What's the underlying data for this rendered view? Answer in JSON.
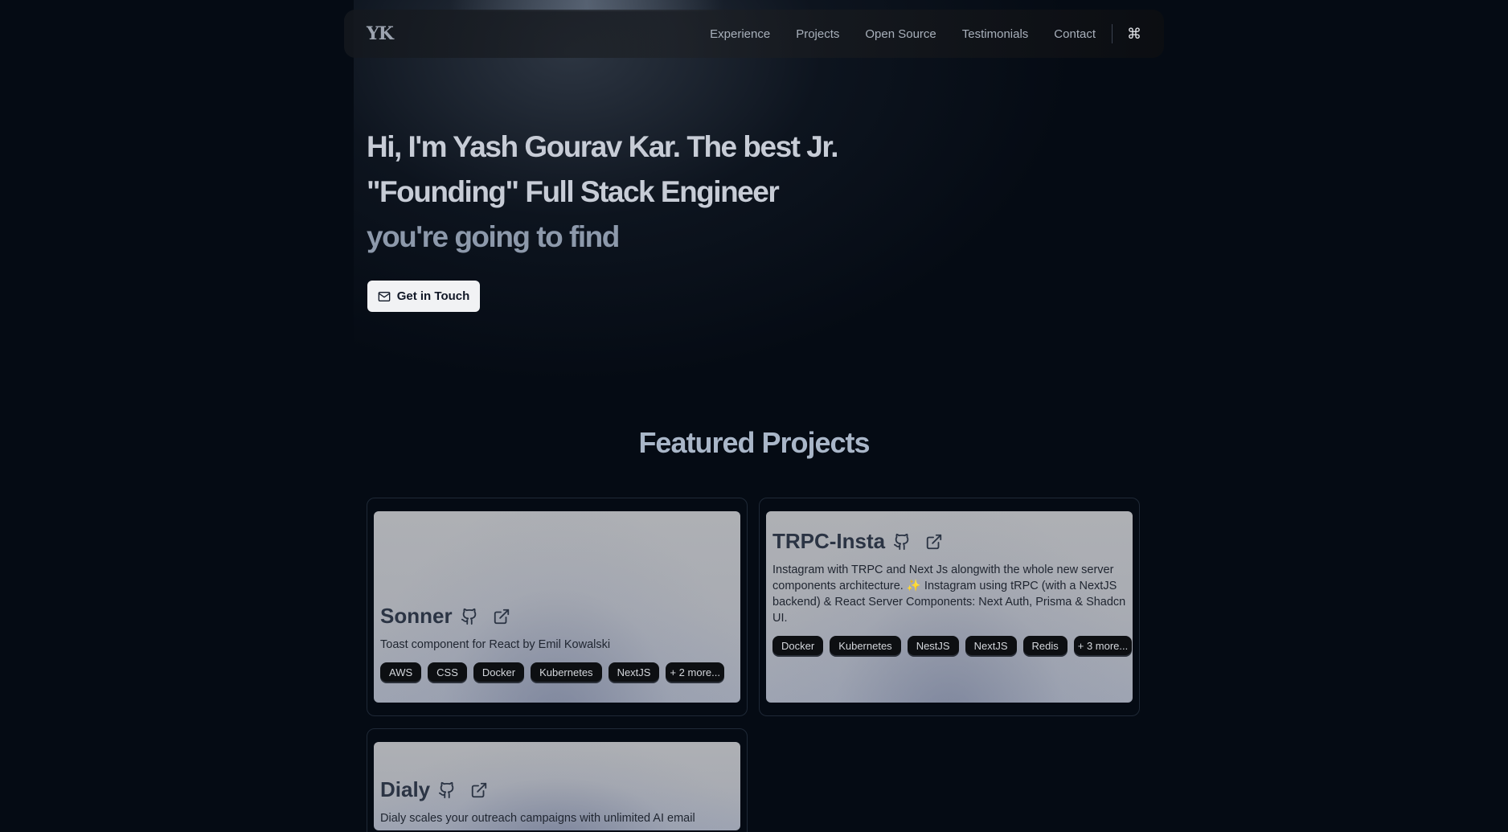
{
  "nav": {
    "logo": "YK",
    "links": [
      "Experience",
      "Projects",
      "Open Source",
      "Testimonials",
      "Contact"
    ],
    "command_icon": "⌘"
  },
  "hero": {
    "line1": "Hi, I'm Yash Gourav Kar. The best Jr.",
    "line2": "\"Founding\" Full Stack Engineer",
    "line3": "you're going to find",
    "cta_label": "Get in Touch",
    "cta_icon": "mail-icon"
  },
  "projects": {
    "title": "Featured Projects",
    "items": [
      {
        "name": "Sonner",
        "description": "Toast component for React by Emil Kowalski",
        "tags": [
          "AWS",
          "CSS",
          "Docker",
          "Kubernetes",
          "NextJS"
        ],
        "more": "+ 2 more..."
      },
      {
        "name": "TRPC-Insta",
        "description": "Instagram with TRPC and Next Js alongwith the whole new server components architecture. ✨ Instagram using tRPC (with a NextJS backend) & React Server Components: Next Auth, Prisma & Shadcn UI.",
        "tags": [
          "Docker",
          "Kubernetes",
          "NestJS",
          "NextJS",
          "Redis"
        ],
        "more": "+ 3 more..."
      },
      {
        "name": "Dialy",
        "description": "Dialy scales your outreach campaigns with unlimited AI email"
      }
    ]
  },
  "colors": {
    "background": "#050b14",
    "card": "#aeb0b4",
    "tag": "#0d0f12",
    "heading": "#a9b6c8"
  }
}
